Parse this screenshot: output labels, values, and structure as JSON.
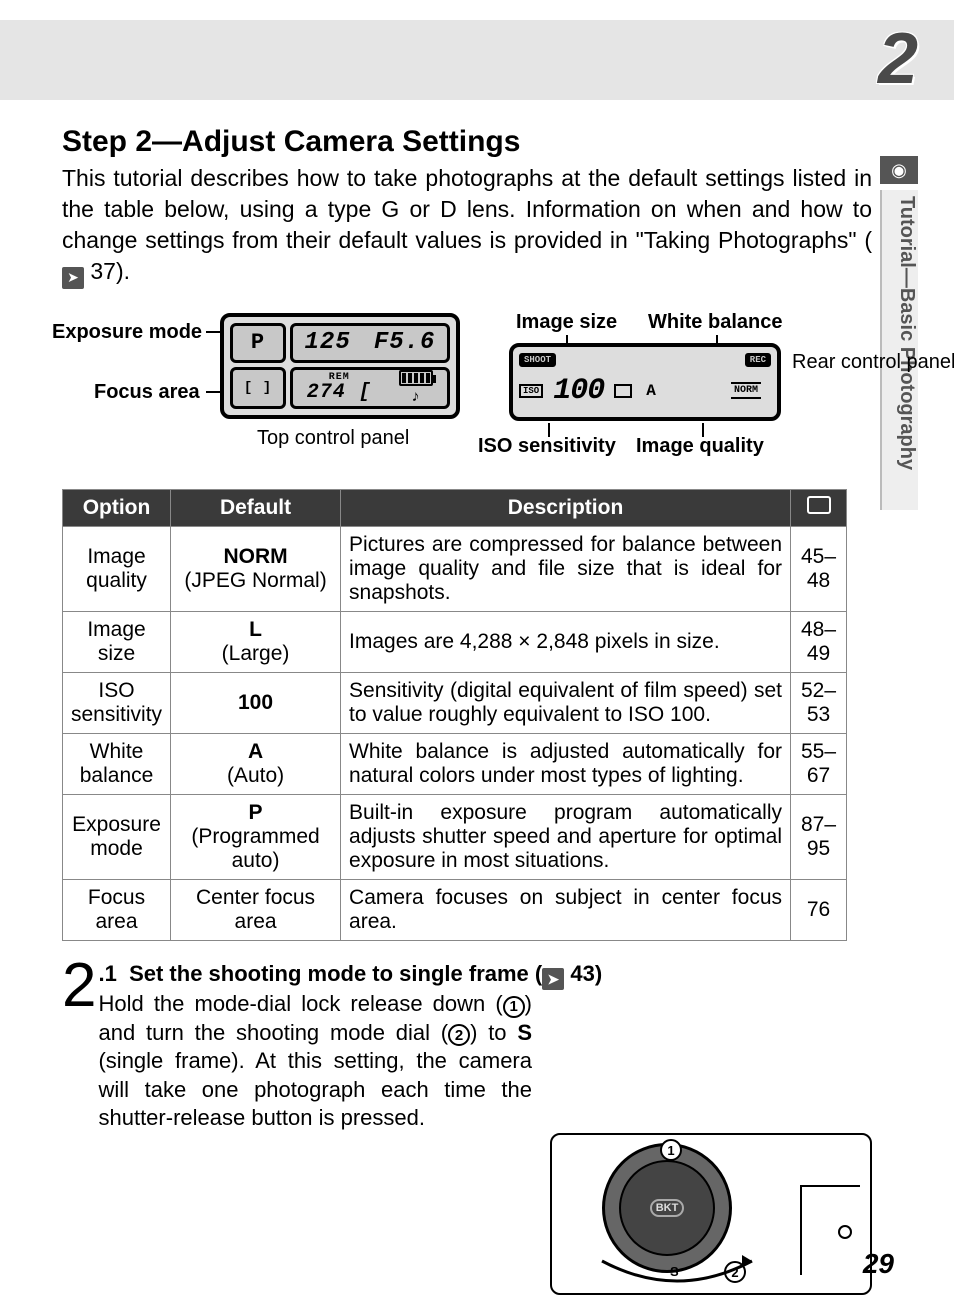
{
  "chapter": "2",
  "sideTab": "Tutorial—Basic Photography",
  "heading": "Step 2—Adjust Camera Settings",
  "intro": "This tutorial describes how to take photographs at the default settings listed in the table below, using a type G or D lens.  Information on when and how to change settings from their default values is provided in \"Taking Photographs\" (",
  "introRef": "37",
  "introEnd": ").",
  "diagram": {
    "exposureMode": "Exposure mode",
    "focusArea": "Focus area",
    "topPanel": "Top control panel",
    "imageSize": "Image size",
    "whiteBalance": "White balance",
    "rearPanel": "Rear control panel",
    "isoSensitivity": "ISO sensitivity",
    "imageQuality": "Image quality",
    "topValues": {
      "P": "P",
      "shutter": "125",
      "aperture": "F5.6",
      "rem": "REM",
      "remVal": "274 ["
    },
    "rearValues": {
      "shoot": "SHOOT",
      "iso": "ISO",
      "isoVal": "100",
      "rec": "REC",
      "A": "A",
      "norm": "NORM"
    }
  },
  "table": {
    "headers": {
      "option": "Option",
      "default": "Default",
      "description": "Description"
    },
    "rows": [
      {
        "option": "Image quality",
        "defBold": "NORM",
        "defSub": "(JPEG Normal)",
        "desc": "Pictures are compressed for balance between image quality and file size that is ideal for snapshots.",
        "page": "45–48"
      },
      {
        "option": "Image size",
        "defBold": "L",
        "defSub": "(Large)",
        "desc": "Images are 4,288 × 2,848 pixels in size.",
        "page": "48–49"
      },
      {
        "option": "ISO sensitivity",
        "defBold": "100",
        "defSub": "",
        "desc": "Sensitivity (digital equivalent of film speed) set to value roughly equivalent to ISO 100.",
        "page": "52–53"
      },
      {
        "option": "White balance",
        "defBold": "A",
        "defSub": "(Auto)",
        "desc": "White balance is adjusted automatically for natural colors under most types of lighting.",
        "page": "55–67"
      },
      {
        "option": "Exposure mode",
        "defBold": "P",
        "defSub": "(Programmed auto)",
        "desc": "Built-in exposure program automatically adjusts shutter speed and aperture for optimal exposure in most situations.",
        "page": "87–95"
      },
      {
        "option": "Focus area",
        "defBold": "",
        "defSub": "Center focus area",
        "desc": "Camera focuses on subject in center focus area.",
        "page": "76"
      }
    ]
  },
  "step": {
    "num": "2",
    "sub": ".1",
    "titleA": "Set the shooting mode to single frame (",
    "titleRef": "43",
    "titleB": ")",
    "body1": "Hold the mode-dial lock release down (",
    "body2": ") and turn the shooting mode dial (",
    "body3": ") to ",
    "bodyS": "S",
    "body4": " (single frame).  At this setting, the camera will take one photograph each time the shutter-release button is pressed.",
    "c1": "1",
    "c2": "2"
  },
  "pageNum": "29"
}
